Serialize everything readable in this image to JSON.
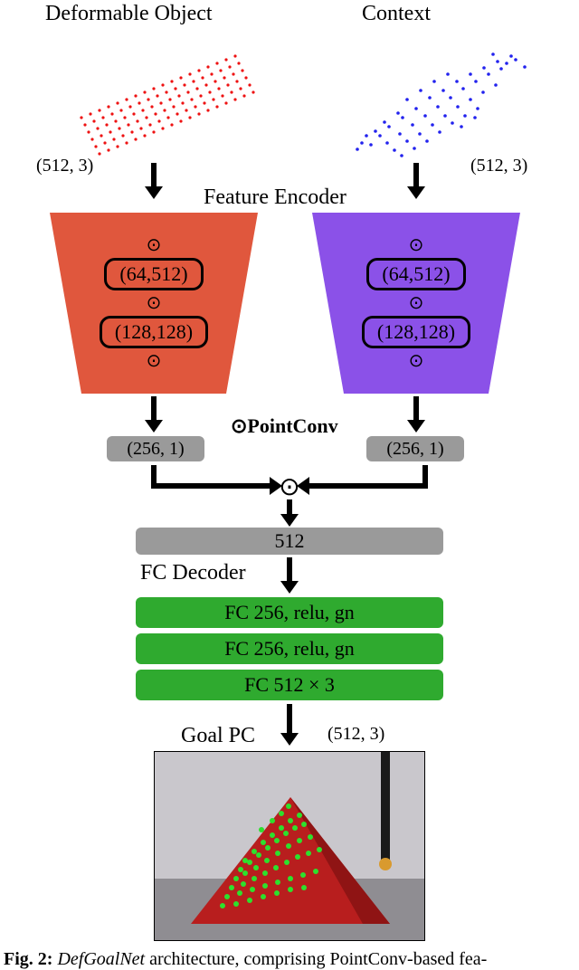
{
  "inputs": {
    "left": {
      "title": "Deformable Object",
      "shape": "(512, 3)"
    },
    "right": {
      "title": "Context",
      "shape": "(512, 3)"
    }
  },
  "encoder": {
    "title": "Feature Encoder",
    "op_label": "⊙PointConv",
    "left_blocks": [
      "(64,512)",
      "(128,128)"
    ],
    "right_blocks": [
      "(64,512)",
      "(128,128)"
    ],
    "op_symbol": "⊙"
  },
  "features": {
    "left": "(256, 1)",
    "right": "(256, 1)",
    "fuse_symbol": "⊙",
    "concat": "512"
  },
  "decoder": {
    "title": "FC Decoder",
    "layers": [
      "FC 256, relu, gn",
      "FC 256, relu, gn",
      "FC 512 × 3"
    ]
  },
  "output": {
    "title": "Goal PC",
    "shape": "(512, 3)"
  },
  "caption": {
    "fig": "Fig. 2:",
    "name": "DefGoalNet",
    "rest": " architecture, comprising PointConv-based fea-"
  }
}
